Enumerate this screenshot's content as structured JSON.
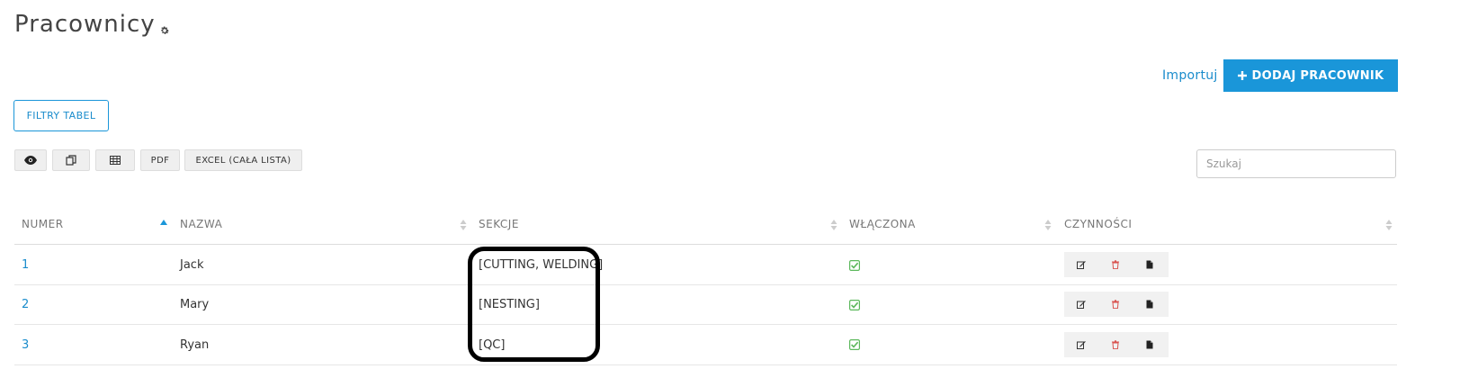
{
  "page": {
    "title": "Pracownicy"
  },
  "header": {
    "import_label": "Importuj",
    "add_label": "DODAJ PRACOWNIK",
    "add_icon": "plus-icon"
  },
  "filters": {
    "label": "FILTRY TABEL"
  },
  "toolbar": {
    "buttons": [
      {
        "icon": "eye-icon",
        "label": ""
      },
      {
        "icon": "copy-icon",
        "label": ""
      },
      {
        "icon": "table-icon",
        "label": ""
      },
      {
        "icon": "",
        "label": "PDF"
      },
      {
        "icon": "",
        "label": "EXCEL (CAŁA LISTA)"
      }
    ]
  },
  "search": {
    "placeholder": "Szukaj",
    "value": ""
  },
  "table": {
    "columns": [
      "NUMER",
      "NAZWA",
      "SEKCJE",
      "WŁĄCZONA",
      "CZYNNOŚCI"
    ],
    "sorted_column": "NUMER",
    "rows": [
      {
        "number": "1",
        "name": "Jack",
        "sections": "[CUTTING, WELDING]",
        "enabled": true
      },
      {
        "number": "2",
        "name": "Mary",
        "sections": "[NESTING]",
        "enabled": true
      },
      {
        "number": "3",
        "name": "Ryan",
        "sections": "[QC]",
        "enabled": true
      }
    ],
    "row_actions": [
      "edit-icon",
      "trash-icon",
      "document-icon"
    ]
  },
  "colors": {
    "accent": "#1a96d9",
    "link": "#1a8ccc",
    "enabled_check": "#5cb85c",
    "delete": "#d9534f",
    "highlight_outline": "#000000"
  }
}
